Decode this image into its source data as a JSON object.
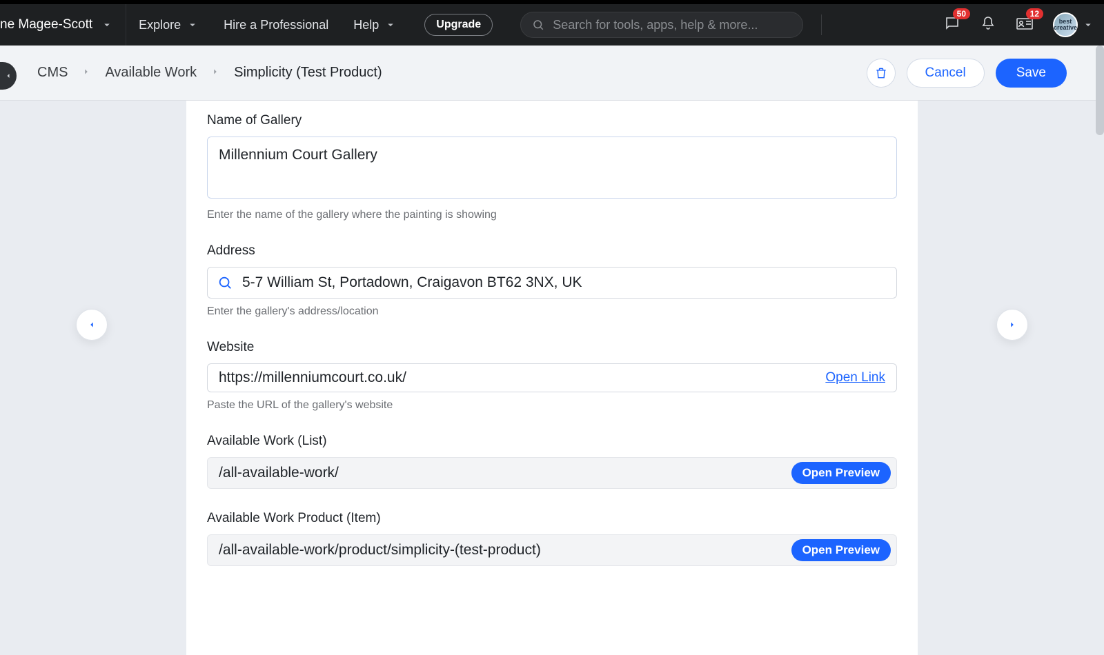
{
  "topnav": {
    "site_name_partial": "ne Magee-Scott",
    "explore": "Explore",
    "hire": "Hire a Professional",
    "help": "Help",
    "upgrade": "Upgrade",
    "search_placeholder": "Search for tools, apps, help & more...",
    "badge_messages": "50",
    "badge_id": "12",
    "avatar_text": "best\ncreative"
  },
  "breadcrumbs": {
    "root": "CMS",
    "mid": "Available Work",
    "current": "Simplicity (Test Product)",
    "cancel": "Cancel",
    "save": "Save"
  },
  "fields": {
    "gallery_name": {
      "label": "Name of Gallery",
      "value": "Millennium Court Gallery",
      "help": "Enter the name of the gallery where the painting is showing"
    },
    "address": {
      "label": "Address",
      "value": "5-7 William St, Portadown, Craigavon BT62 3NX, UK",
      "help": "Enter the gallery's address/location"
    },
    "website": {
      "label": "Website",
      "value": "https://millenniumcourt.co.uk/",
      "open_link": "Open Link",
      "help": "Paste the URL of the gallery's website"
    },
    "list_page": {
      "label": "Available Work (List)",
      "value": "/all-available-work/",
      "open_preview": "Open Preview"
    },
    "item_page": {
      "label": "Available Work Product (Item)",
      "value": "/all-available-work/product/simplicity-(test-product)",
      "open_preview": "Open Preview"
    }
  }
}
